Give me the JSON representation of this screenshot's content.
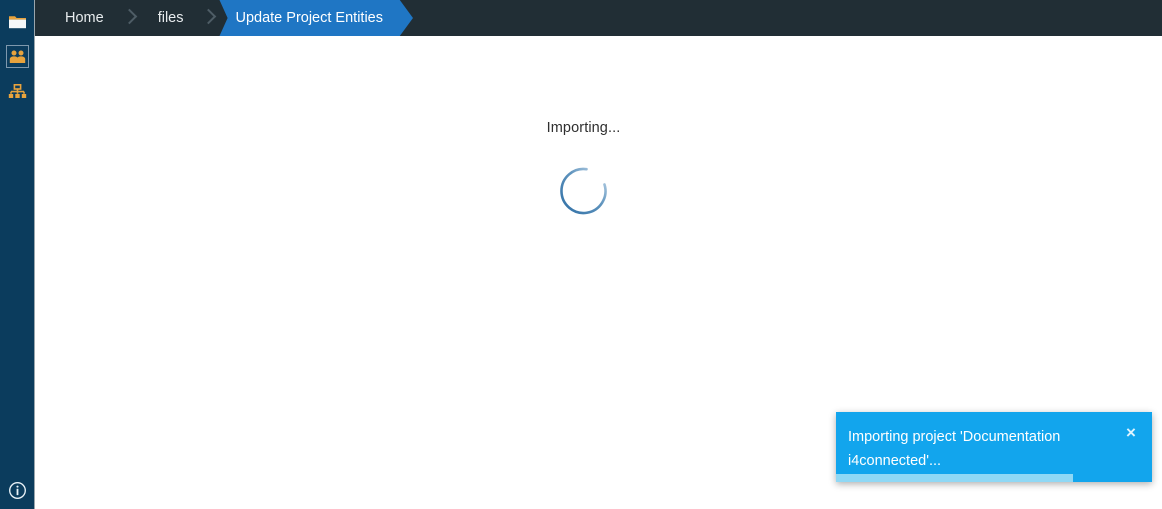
{
  "colors": {
    "sidebar_bg": "#0b3c5d",
    "header_bg": "#212e35",
    "breadcrumb_active_bg": "#1f76c4",
    "toast_bg": "#12a5ed",
    "toast_progress_fill": "#8fd8f5",
    "spinner_stroke": "#2f6fa5",
    "content_bg": "#ffffff",
    "icon_gold": "#e8a33d"
  },
  "sidebar": {
    "items": [
      {
        "icon": "folder-icon",
        "selected": false
      },
      {
        "icon": "users-icon",
        "selected": true
      },
      {
        "icon": "org-chart-icon",
        "selected": false
      }
    ],
    "footer": {
      "icon": "info-circle-icon"
    }
  },
  "header": {
    "breadcrumb": [
      {
        "label": "Home",
        "active": false
      },
      {
        "label": "files",
        "active": false
      },
      {
        "label": "Update Project Entities",
        "active": true
      }
    ]
  },
  "main": {
    "loading_label": "Importing...",
    "spinner": "loading-spinner"
  },
  "toast": {
    "message": "Importing project 'Documentation i4connected'...",
    "close_label": "×",
    "progress_percent": 75
  }
}
